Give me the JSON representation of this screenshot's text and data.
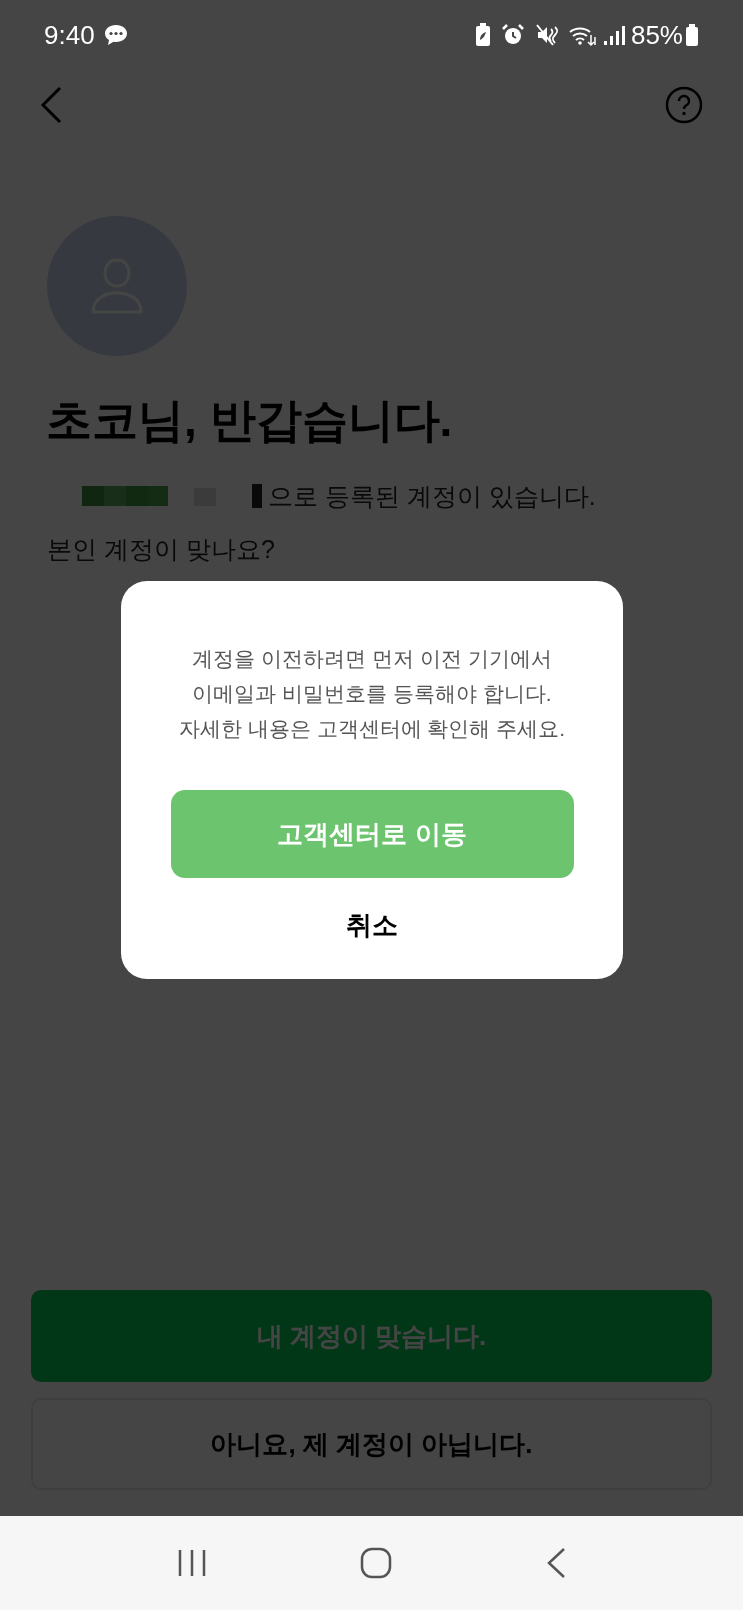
{
  "status_bar": {
    "time": "9:40",
    "battery": "85%"
  },
  "greeting": {
    "title": "초코님, 반갑습니다.",
    "message": "으로 등록된 계정이 있습니다.",
    "question": "본인 계정이 맞나요?"
  },
  "buttons": [
    {
      "label": "내 계정이 맞습니다.",
      "kind": "primary"
    },
    {
      "label": "아니요, 제 계정이 아닙니다.",
      "kind": "outline"
    }
  ],
  "dialog": {
    "message_lines": [
      "계정을 이전하려면 먼저 이전 기기에서",
      "이메일과 비밀번호를 등록해야 합니다.",
      "자세한 내용은 고객센터에 확인해 주세요."
    ],
    "confirm": "고객센터로 이동",
    "cancel": "취소"
  }
}
